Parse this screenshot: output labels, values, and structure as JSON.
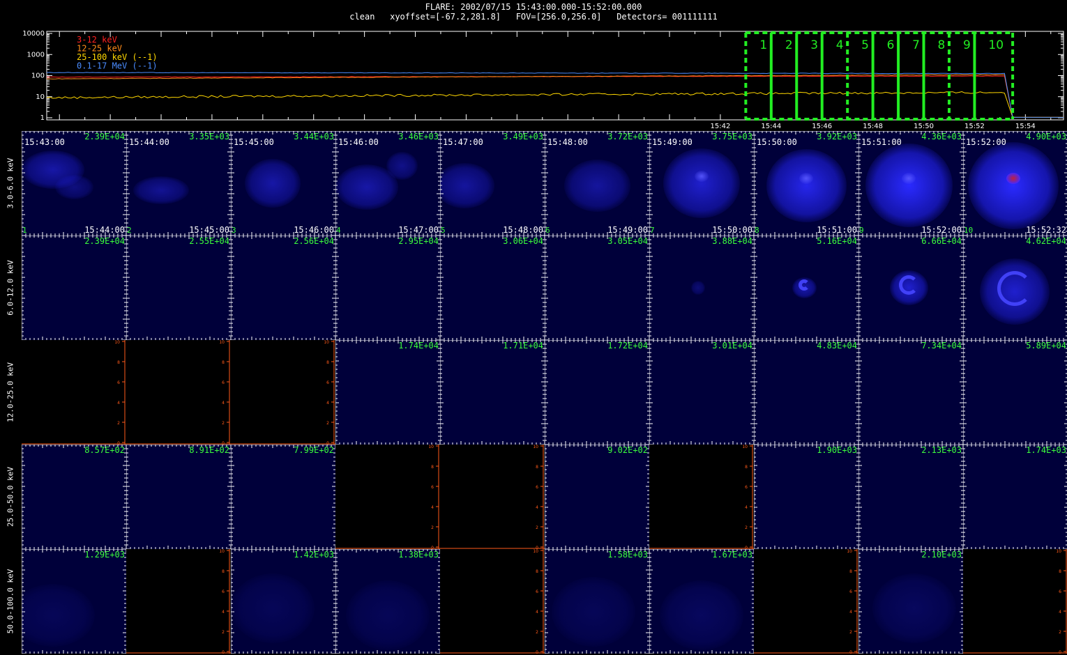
{
  "header": {
    "title": "FLARE: 2002/07/15 15:43:00.000-15:52:00.000",
    "subtitle": "clean   xyoffset=[-67.2,281.8]   FOV=[256.0,256.0]   Detectors= 001111111"
  },
  "lightcurve": {
    "y_ticks": [
      "10000",
      "1000",
      "100",
      "10",
      "1"
    ],
    "x_ticks": [
      "15:42",
      "15:44",
      "15:46",
      "15:48",
      "15:50",
      "15:52",
      "15:54"
    ],
    "legend": [
      {
        "label": "3-12 keV",
        "color": "#ff2020"
      },
      {
        "label": "12-25 keV",
        "color": "#ff8c1a"
      },
      {
        "label": "25-100 keV (--1)",
        "color": "#ffd700"
      },
      {
        "label": "0.1-17 MeV (--1)",
        "color": "#4a8cff"
      }
    ],
    "interval_labels": [
      "1",
      "2",
      "3",
      "4",
      "5",
      "6",
      "7",
      "8",
      "9",
      "10"
    ],
    "interval_color": "#22ee22",
    "x_range_minutes": [
      15.5,
      55.5
    ],
    "y_range_log": [
      1,
      10000
    ],
    "series": [
      {
        "name": "3-12 keV",
        "start": 85,
        "end": 95
      },
      {
        "name": "12-25 keV",
        "start": 70,
        "end": 110
      },
      {
        "name": "25-100 keV (--1)",
        "start": 9,
        "end": 16
      },
      {
        "name": "0.1-17 MeV (--1)",
        "start": 140,
        "end": 125
      }
    ]
  },
  "energy_bands": [
    "3.0-6.0 keV",
    "6.0-12.0 keV",
    "12.0-25.0 keV",
    "25.0-50.0 keV",
    "50.0-100.0 keV"
  ],
  "time_starts": [
    "15:43:00",
    "15:44:00",
    "15:45:00",
    "15:46:00",
    "15:47:00",
    "15:48:00",
    "15:49:00",
    "15:50:00",
    "15:51:00",
    "15:52:00"
  ],
  "time_ends": [
    "15:44:00",
    "15:45:00",
    "15:46:00",
    "15:47:00",
    "15:48:00",
    "15:49:00",
    "15:50:00",
    "15:51:00",
    "15:52:00",
    "15:52:32"
  ],
  "cell_indices": [
    "1",
    "2",
    "3",
    "4",
    "5",
    "6",
    "7",
    "8",
    "9",
    "10"
  ],
  "flux_rows": [
    [
      "2.39E+04",
      "3.35E+03",
      "3.44E+03",
      "3.46E+03",
      "3.49E+03",
      "3.72E+03",
      "3.75E+03",
      "3.92E+03",
      "4.36E+03",
      "4.90E+03"
    ],
    [
      "2.39E+04",
      "2.55E+04",
      "2.56E+04",
      "2.95E+04",
      "3.06E+04",
      "3.05E+04",
      "3.88E+04",
      "5.16E+04",
      "6.66E+04",
      "4.62E+04"
    ],
    [
      "",
      "",
      "",
      "1.74E+04",
      "1.71E+04",
      "1.72E+04",
      "3.01E+04",
      "4.83E+04",
      "7.34E+04",
      "5.89E+04"
    ],
    [
      "8.57E+02",
      "8.91E+02",
      "7.99E+02",
      "",
      "",
      "9.02E+02",
      "",
      "1.90E+03",
      "2.13E+03",
      "1.74E+03"
    ],
    [
      "1.29E+03",
      "",
      "1.42E+03",
      "1.38E+03",
      "",
      "1.58E+03",
      "1.67E+03",
      "",
      "2.10E+03",
      ""
    ]
  ],
  "empty_cells": [
    [
      false,
      false,
      false,
      false,
      false,
      false,
      false,
      false,
      false,
      false
    ],
    [
      false,
      false,
      false,
      false,
      false,
      false,
      false,
      false,
      false,
      false
    ],
    [
      true,
      true,
      true,
      false,
      false,
      false,
      false,
      false,
      false,
      false
    ],
    [
      false,
      false,
      false,
      true,
      true,
      false,
      true,
      false,
      false,
      false
    ],
    [
      false,
      true,
      false,
      false,
      true,
      false,
      false,
      true,
      false,
      true
    ]
  ],
  "colors": {
    "image_background": "#00003a",
    "empty_background": "#000000",
    "flux_text": "#3cff3c",
    "empty_axis": "#ff5a1a",
    "source_blue": "#2a2aff",
    "source_peak": "#c0203a"
  }
}
